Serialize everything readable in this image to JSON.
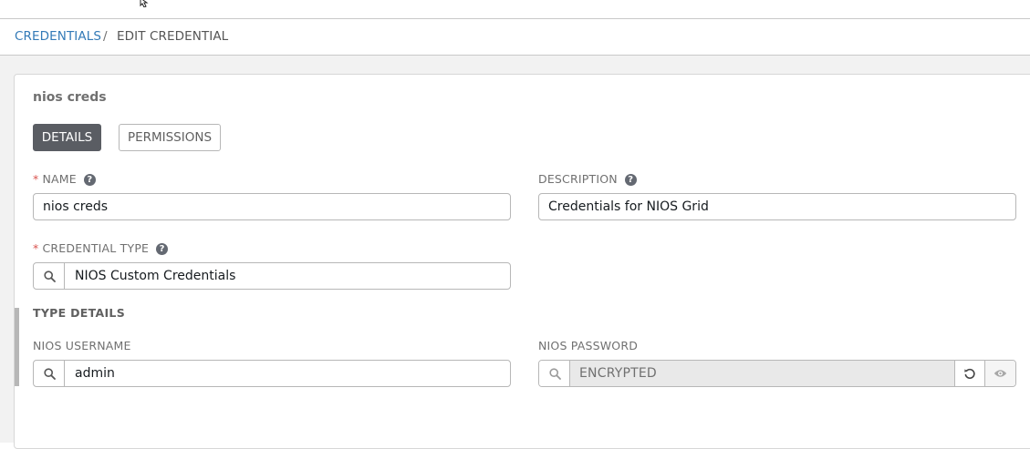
{
  "breadcrumb": {
    "parent": "CREDENTIALS",
    "separator": "/",
    "current": "EDIT CREDENTIAL"
  },
  "panel": {
    "title": "nios creds",
    "tabs": [
      {
        "label": "DETAILS",
        "active": true
      },
      {
        "label": "PERMISSIONS",
        "active": false
      }
    ]
  },
  "form": {
    "name": {
      "required_mark": "*",
      "label": "NAME",
      "value": "nios creds"
    },
    "description": {
      "label": "DESCRIPTION",
      "value": "Credentials for NIOS Grid"
    },
    "credential_type": {
      "required_mark": "*",
      "label": "CREDENTIAL TYPE",
      "value": "NIOS Custom Credentials"
    }
  },
  "type_details": {
    "title": "TYPE DETAILS",
    "username": {
      "label": "NIOS USERNAME",
      "value": "admin"
    },
    "password": {
      "label": "NIOS PASSWORD",
      "value": "ENCRYPTED"
    }
  },
  "icons": {
    "help": "question-circle-icon",
    "lookup": "search-icon",
    "revert": "undo-icon",
    "reveal": "eye-icon"
  },
  "colors": {
    "link": "#337ab7",
    "required": "#d9534f",
    "active_tab": "#5a5d63"
  }
}
